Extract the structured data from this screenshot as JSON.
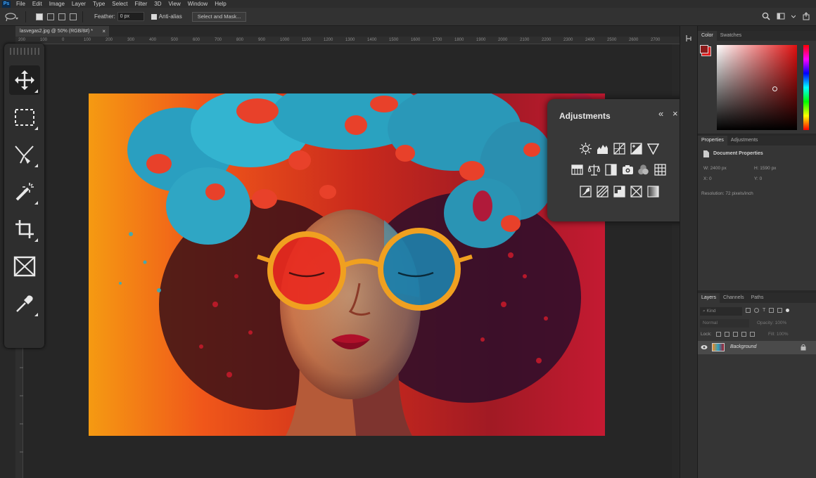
{
  "app": {
    "logo": "Ps"
  },
  "menu": [
    "File",
    "Edit",
    "Image",
    "Layer",
    "Type",
    "Select",
    "Filter",
    "3D",
    "View",
    "Window",
    "Help"
  ],
  "options": {
    "feather_label": "Feather:",
    "feather_value": "0 px",
    "antialias_label": "Anti-alias",
    "select_mask_label": "Select and Mask..."
  },
  "document": {
    "tab_title": "lasvegas2.jpg @ 50% (RGB/8#) *",
    "close": "×"
  },
  "ruler_ticks": [
    "200",
    "100",
    "0",
    "100",
    "200",
    "300",
    "400",
    "500",
    "600",
    "700",
    "800",
    "900",
    "1000",
    "1100",
    "1200",
    "1300",
    "1400",
    "1500",
    "1600",
    "1700",
    "1800",
    "1900",
    "2000",
    "2100",
    "2200",
    "2300",
    "2400",
    "2500",
    "2600",
    "2700"
  ],
  "tools": [
    "move-tool",
    "rect-marquee-tool",
    "lasso-tool",
    "magic-wand-tool",
    "crop-tool",
    "frame-tool",
    "eyedropper-tool"
  ],
  "adjustments": {
    "title": "Adjustments",
    "collapse": "«",
    "close": "×",
    "rows": [
      [
        "brightness-icon",
        "levels-icon",
        "curves-icon",
        "exposure-icon",
        "vibrance-icon"
      ],
      [
        "hue-saturation-icon",
        "color-balance-icon",
        "black-white-icon",
        "photo-filter-icon",
        "channel-mixer-icon",
        "color-lookup-icon"
      ],
      [
        "invert-icon",
        "posterize-icon",
        "threshold-icon",
        "selective-color-icon",
        "gradient-map-icon"
      ]
    ]
  },
  "color_panel": {
    "tabs": [
      "Color",
      "Swatches"
    ],
    "foreground": "#8b1a1a",
    "background": "#e02020"
  },
  "properties_panel": {
    "tabs": [
      "Properties",
      "Adjustments"
    ],
    "heading": "Document Properties",
    "w": "W:  2400 px",
    "h": "H:  1590 px",
    "x": "X:  0",
    "y": "Y:  0",
    "resolution": "Resolution:  72 pixels/inch"
  },
  "layers_panel": {
    "tabs": [
      "Layers",
      "Channels",
      "Paths"
    ],
    "filter_placeholder": "Kind",
    "blend_mode": "Normal",
    "opacity": "Opacity: 100%",
    "lock_label": "Lock:",
    "fill": "Fill: 100%",
    "layer_name": "Background"
  }
}
